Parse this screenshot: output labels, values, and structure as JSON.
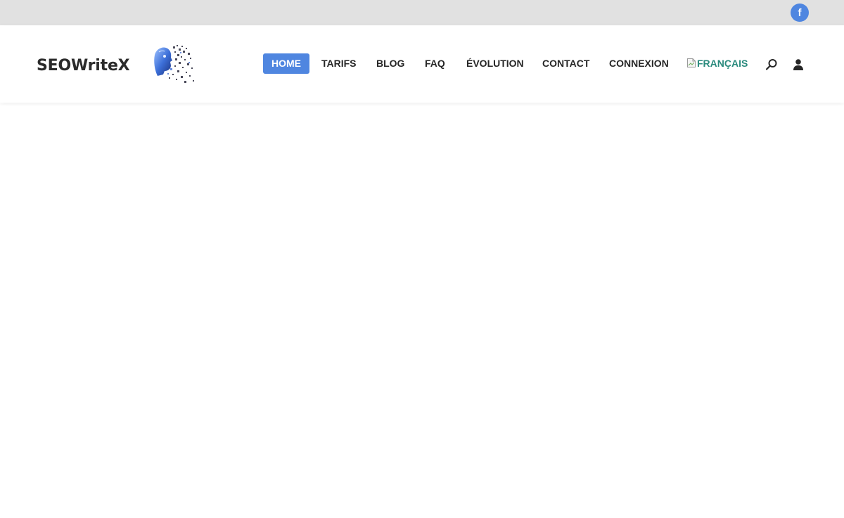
{
  "topbar": {
    "social": {
      "facebook_glyph": "f",
      "icon": "facebook-icon",
      "color": "#4f86e0"
    }
  },
  "header": {
    "logo": {
      "text": "SEOWriteX",
      "icon": "robot-face-logo"
    },
    "nav": {
      "items": [
        {
          "label": "HOME",
          "active": true
        },
        {
          "label": "TARIFS",
          "active": false
        },
        {
          "label": "BLOG",
          "active": false
        },
        {
          "label": "FAQ",
          "active": false
        },
        {
          "label": "ÉVOLUTION",
          "active": false
        },
        {
          "label": "CONTACT",
          "active": false
        },
        {
          "label": "CONNEXION",
          "active": false
        }
      ],
      "language": {
        "label": "FRANÇAIS",
        "icon": "broken-image-icon",
        "color": "#2a8a7d"
      },
      "search_icon": "search-icon",
      "account_icon": "user-icon"
    }
  },
  "theme": {
    "accent": "#4f86e0",
    "topbar_bg": "#e1e1e1",
    "text": "#262626"
  }
}
